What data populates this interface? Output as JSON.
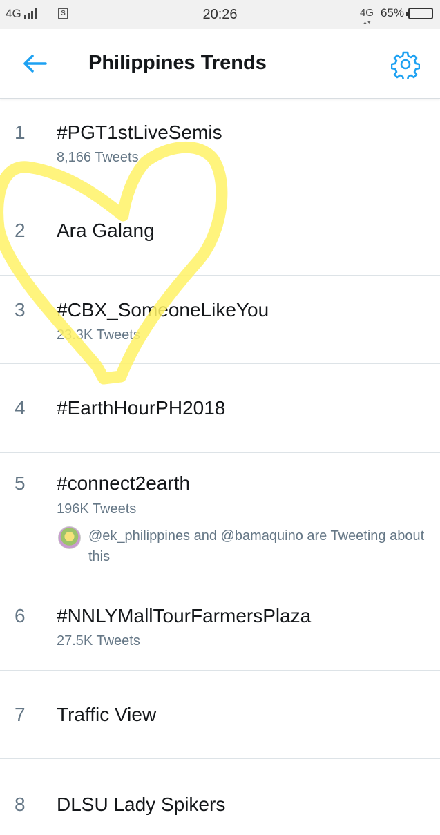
{
  "status_bar": {
    "network_left": "4G",
    "time": "20:26",
    "network_right": "4G",
    "battery_percent_label": "65%",
    "battery_level": 0.65,
    "sim_icon": "sim-card-icon"
  },
  "header": {
    "title": "Philippines Trends",
    "back_icon": "arrow-left-icon",
    "settings_icon": "gear-icon",
    "accent_color": "#1da1f2"
  },
  "trends": [
    {
      "rank": "1",
      "topic": "#PGT1stLiveSemis",
      "tweets": "8,166 Tweets"
    },
    {
      "rank": "2",
      "topic": "Ara Galang"
    },
    {
      "rank": "3",
      "topic": "#CBX_SomeoneLikeYou",
      "tweets": "23.3K Tweets"
    },
    {
      "rank": "4",
      "topic": "#EarthHourPH2018"
    },
    {
      "rank": "5",
      "topic": "#connect2earth",
      "tweets": "196K Tweets",
      "context": "@ek_philippines and @bamaquino are Tweeting about this"
    },
    {
      "rank": "6",
      "topic": "#NNLYMallTourFarmersPlaza",
      "tweets": "27.5K Tweets"
    },
    {
      "rank": "7",
      "topic": "Traffic View"
    },
    {
      "rank": "8",
      "topic": "DLSU Lady Spikers"
    }
  ],
  "overlay": {
    "drawing": "heart-doodle",
    "color": "#fff266"
  }
}
